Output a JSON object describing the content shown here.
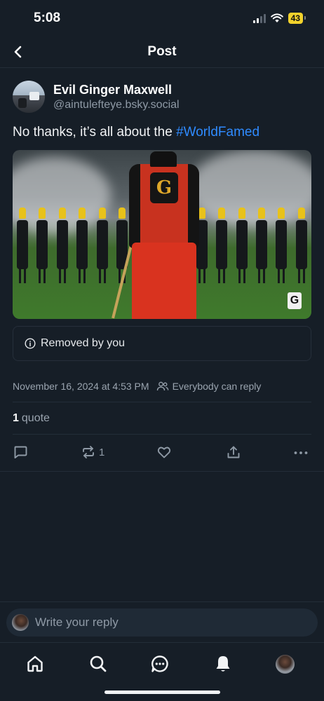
{
  "status_bar": {
    "time": "5:08",
    "battery": "43"
  },
  "header": {
    "title": "Post"
  },
  "post": {
    "display_name": "Evil Ginger Maxwell",
    "handle": "@aintulefteye.bsky.social",
    "text_prefix": "No thanks, it’s all about the ",
    "hashtag": "#WorldFamed",
    "media_crest_letter": "G",
    "media_logo_mark": "G",
    "removed_notice": "Removed by you",
    "timestamp": "November 16, 2024 at 4:53 PM",
    "reply_setting": "Everybody can reply",
    "quote_count": "1",
    "quote_label": "quote",
    "repost_count": "1"
  },
  "reply_bar": {
    "placeholder": "Write your reply"
  },
  "tabs": [
    "home",
    "search",
    "messages",
    "notifications",
    "profile"
  ],
  "icons": {
    "back": "chevron-left-icon",
    "info": "info-icon",
    "people": "people-icon",
    "reply": "comment-icon",
    "repost": "repost-icon",
    "like": "heart-icon",
    "share": "share-icon",
    "more": "ellipsis-icon"
  },
  "colors": {
    "background": "#161e27",
    "accent": "#2f8bff",
    "battery": "#f2d22c"
  }
}
